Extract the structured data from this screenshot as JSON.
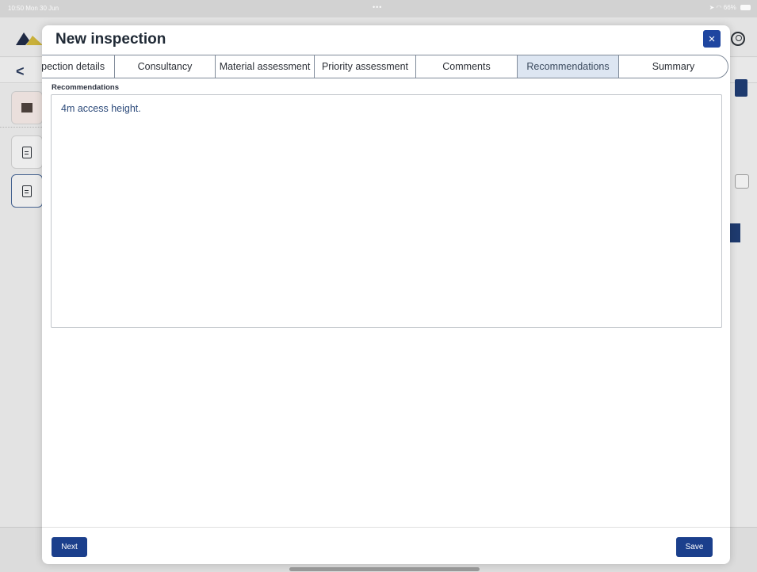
{
  "status_bar": {
    "time": "10:50  Mon 30 Jun",
    "dots": "•••",
    "battery": "66%"
  },
  "background": {
    "back_glyph": "<"
  },
  "modal": {
    "title": "New inspection",
    "close_glyph": "×",
    "tabs": [
      {
        "label": "spection details",
        "active": false
      },
      {
        "label": "Consultancy",
        "active": false
      },
      {
        "label": "Material assessment",
        "active": false
      },
      {
        "label": "Priority assessment",
        "active": false
      },
      {
        "label": "Comments",
        "active": false
      },
      {
        "label": "Recommendations",
        "active": true
      },
      {
        "label": "Summary",
        "active": false
      }
    ],
    "recommendations": {
      "label": "Recommendations",
      "value": "4m access height."
    },
    "footer": {
      "next_label": "Next",
      "save_label": "Save"
    }
  },
  "colors": {
    "primary": "#1b3f8c",
    "active_tab": "#dde6f2",
    "text_value": "#2c4a7a"
  },
  "icons": [
    "app-logo-icon",
    "user-icon",
    "back-icon",
    "building-icon",
    "document-icon",
    "edit-icon",
    "trash-icon",
    "close-icon",
    "wifi-icon",
    "location-icon",
    "battery-icon"
  ]
}
